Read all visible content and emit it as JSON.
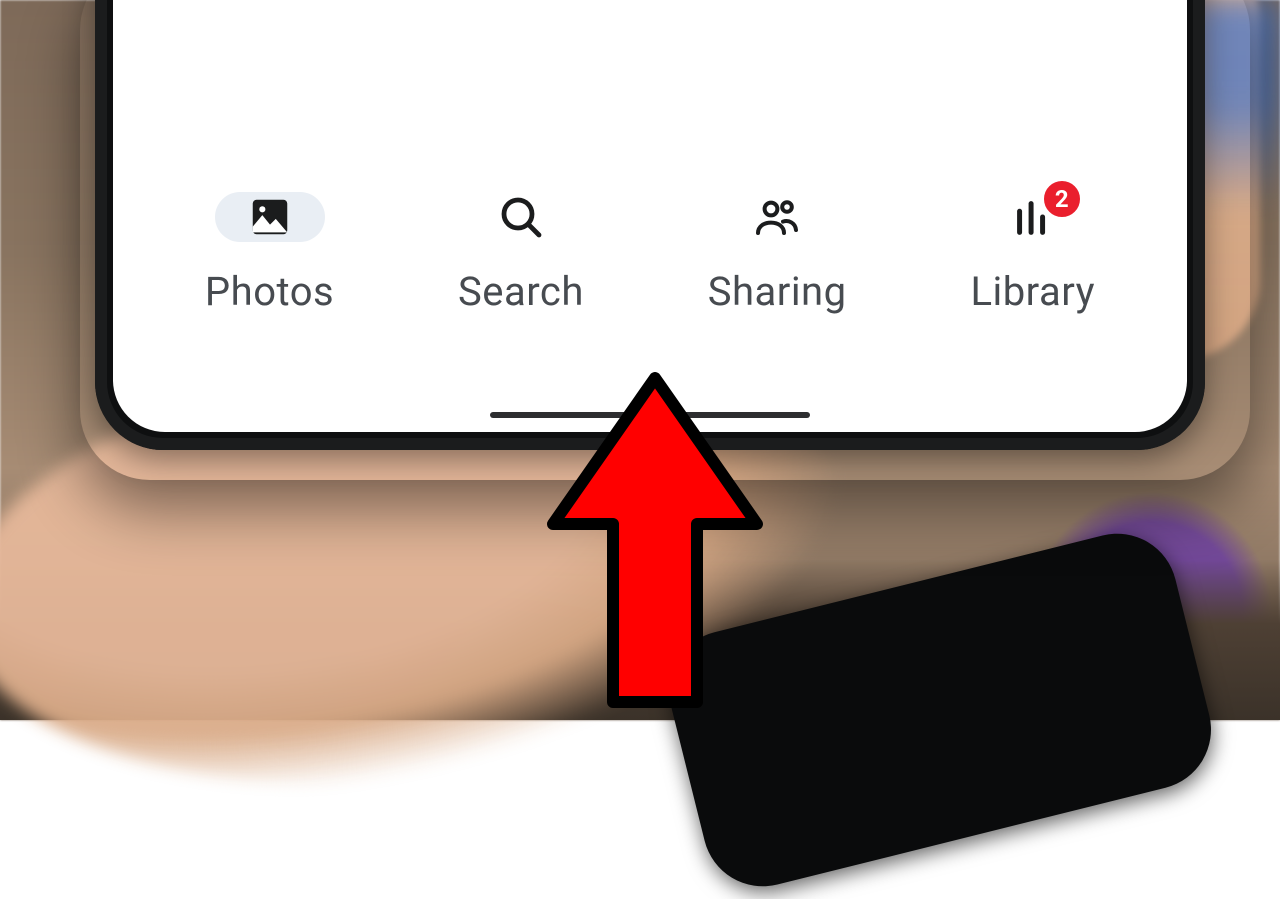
{
  "nav": {
    "items": [
      {
        "label": "Photos",
        "icon": "photo-icon",
        "active": true
      },
      {
        "label": "Search",
        "icon": "search-icon",
        "active": false
      },
      {
        "label": "Sharing",
        "icon": "people-icon",
        "active": false
      },
      {
        "label": "Library",
        "icon": "library-icon",
        "active": false,
        "badge": "2"
      }
    ]
  },
  "badge_color": "#ea1f2d",
  "annotation": {
    "type": "arrow",
    "color": "#ff0000",
    "points_to": "home-indicator"
  }
}
